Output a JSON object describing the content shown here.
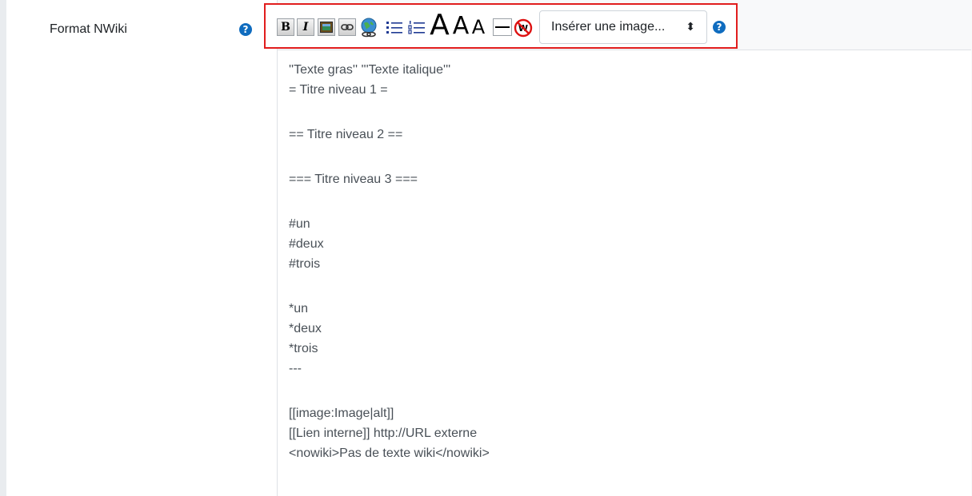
{
  "field": {
    "label": "Format NWiki",
    "help_glyph": "?"
  },
  "toolbar": {
    "bold_label": "B",
    "italic_label": "I",
    "h1_label": "A",
    "h2_label": "A",
    "h3_label": "A",
    "image_select": {
      "value": "Insérer une image...",
      "caret": "⬍"
    },
    "help_glyph": "?",
    "icons": [
      "bold-icon",
      "italic-icon",
      "image-icon",
      "link-icon",
      "external-link-icon",
      "bullet-list-icon",
      "numbered-list-icon",
      "heading-1-icon",
      "heading-2-icon",
      "heading-3-icon",
      "horizontal-rule-icon",
      "nowiki-icon"
    ],
    "accent": "#e11d1d"
  },
  "editor": {
    "lines": [
      "''Texte gras'' '''Texte italique'''",
      "= Titre niveau 1 =",
      "",
      "== Titre niveau 2 ==",
      "",
      "=== Titre niveau 3 ===",
      "",
      "#un",
      "#deux",
      "#trois",
      "",
      "*un",
      "*deux",
      "*trois",
      "---",
      "",
      "[[image:Image|alt]]",
      "[[Lien interne]] http://URL externe",
      "<nowiki>Pas de texte wiki</nowiki>"
    ]
  }
}
